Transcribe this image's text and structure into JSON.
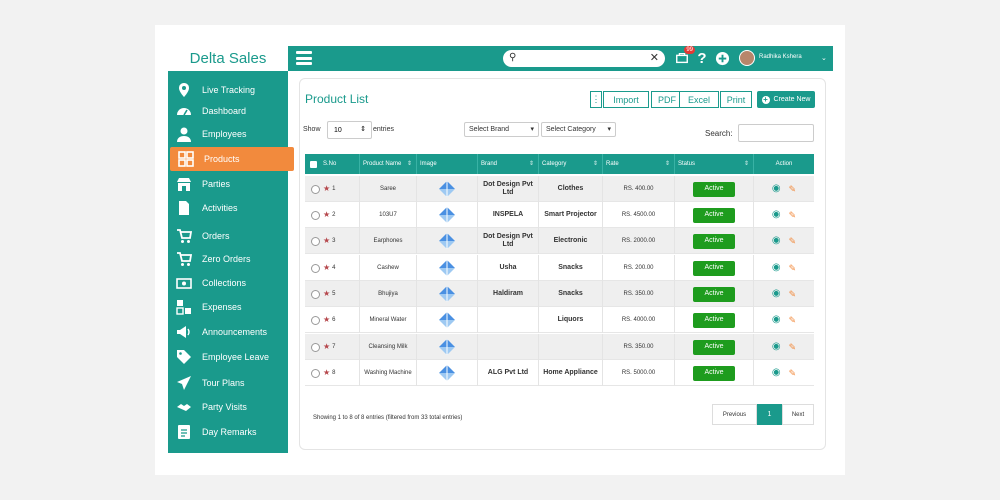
{
  "brand": "Delta Sales",
  "sidebar": {
    "items": [
      {
        "label": "Live Tracking",
        "icon": "location-pin-icon"
      },
      {
        "label": "Dashboard",
        "icon": "speedometer-icon"
      },
      {
        "label": "Employees",
        "icon": "user-icon"
      },
      {
        "label": "Products",
        "icon": "grid-icon",
        "active": true
      },
      {
        "label": "Parties",
        "icon": "store-icon"
      },
      {
        "label": "Activities",
        "icon": "document-icon"
      },
      {
        "label": "Orders",
        "icon": "cart-icon"
      },
      {
        "label": "Zero Orders",
        "icon": "cart-empty-icon"
      },
      {
        "label": "Collections",
        "icon": "money-icon"
      },
      {
        "label": "Expenses",
        "icon": "expenses-icon"
      },
      {
        "label": "Announcements",
        "icon": "megaphone-icon"
      },
      {
        "label": "Employee Leave",
        "icon": "tag-icon"
      },
      {
        "label": "Tour Plans",
        "icon": "paper-plane-icon"
      },
      {
        "label": "Party Visits",
        "icon": "handshake-icon"
      },
      {
        "label": "Day Remarks",
        "icon": "notepad-icon"
      }
    ]
  },
  "topbar": {
    "search_placeholder": "",
    "badge": "99",
    "user_name": "Radhika Kshera"
  },
  "main": {
    "title": "Product List",
    "buttons": {
      "import": "Import",
      "pdf": "PDF",
      "excel": "Excel",
      "print": "Print",
      "create": "Create New"
    },
    "show_label": "Show",
    "entries_value": "10",
    "entries_label": "entries",
    "brand_filter": "Select Brand",
    "category_filter": "Select Category",
    "search_label": "Search:"
  },
  "table": {
    "columns": [
      "S.No",
      "Product Name",
      "Image",
      "Brand",
      "Category",
      "Rate",
      "Status",
      "Action"
    ],
    "rows": [
      {
        "sno": "1",
        "name": "Saree",
        "brand": "Dot Design Pvt Ltd",
        "category": "Clothes",
        "rate": "RS. 400.00",
        "status": "Active"
      },
      {
        "sno": "2",
        "name": "103U7",
        "brand": "INSPELA",
        "category": "Smart Projector",
        "rate": "RS. 4500.00",
        "status": "Active"
      },
      {
        "sno": "3",
        "name": "Earphones",
        "brand": "Dot Design Pvt Ltd",
        "category": "Electronic",
        "rate": "RS. 2000.00",
        "status": "Active"
      },
      {
        "sno": "4",
        "name": "Cashew",
        "brand": "Usha",
        "category": "Snacks",
        "rate": "RS. 200.00",
        "status": "Active"
      },
      {
        "sno": "5",
        "name": "Bhujiya",
        "brand": "Haldiram",
        "category": "Snacks",
        "rate": "RS. 350.00",
        "status": "Active"
      },
      {
        "sno": "6",
        "name": "Mineral Water",
        "brand": "",
        "category": "Liquors",
        "rate": "RS. 4000.00",
        "status": "Active"
      },
      {
        "sno": "7",
        "name": "Cleansing Milk",
        "brand": "",
        "category": "",
        "rate": "RS. 350.00",
        "status": "Active"
      },
      {
        "sno": "8",
        "name": "Washing Machine",
        "brand": "ALG Pvt Ltd",
        "category": "Home Appliance",
        "rate": "RS. 5000.00",
        "status": "Active"
      }
    ]
  },
  "footer": {
    "showing": "Showing 1 to 8 of 8 entries (filtered from 33 total entries)",
    "previous": "Previous",
    "page": "1",
    "next": "Next"
  },
  "colors": {
    "primary": "#1a9a8c",
    "accent": "#f28a3d",
    "active": "#1e9c1e",
    "star": "#b5464b"
  }
}
